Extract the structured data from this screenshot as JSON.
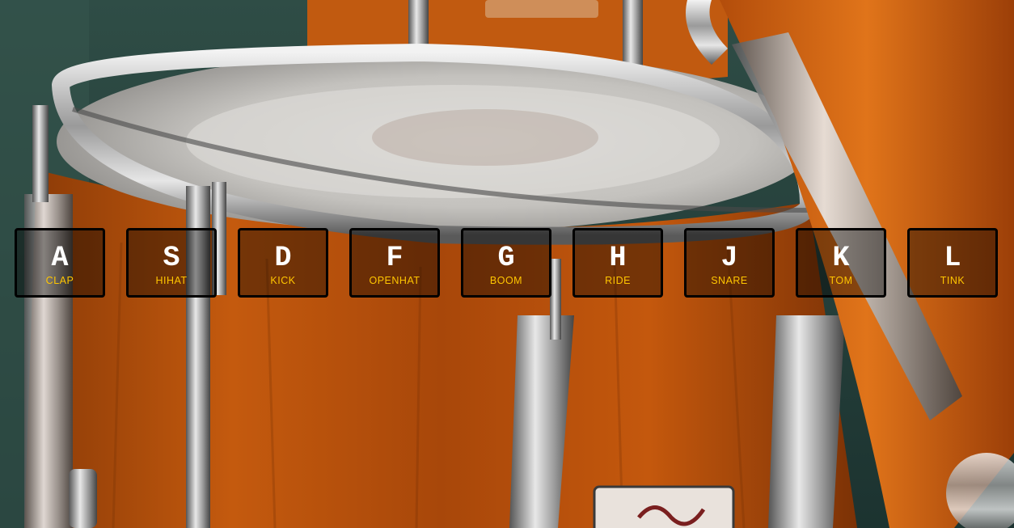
{
  "keys": [
    {
      "letter": "A",
      "sound": "CLAP"
    },
    {
      "letter": "S",
      "sound": "HIHAT"
    },
    {
      "letter": "D",
      "sound": "KICK"
    },
    {
      "letter": "F",
      "sound": "OPENHAT"
    },
    {
      "letter": "G",
      "sound": "BOOM"
    },
    {
      "letter": "H",
      "sound": "RIDE"
    },
    {
      "letter": "J",
      "sound": "SNARE"
    },
    {
      "letter": "K",
      "sound": "TOM"
    },
    {
      "letter": "L",
      "sound": "TINK"
    }
  ],
  "colors": {
    "key_letter": "#ffffff",
    "sound_label": "#ffc600",
    "key_border": "#000000"
  }
}
